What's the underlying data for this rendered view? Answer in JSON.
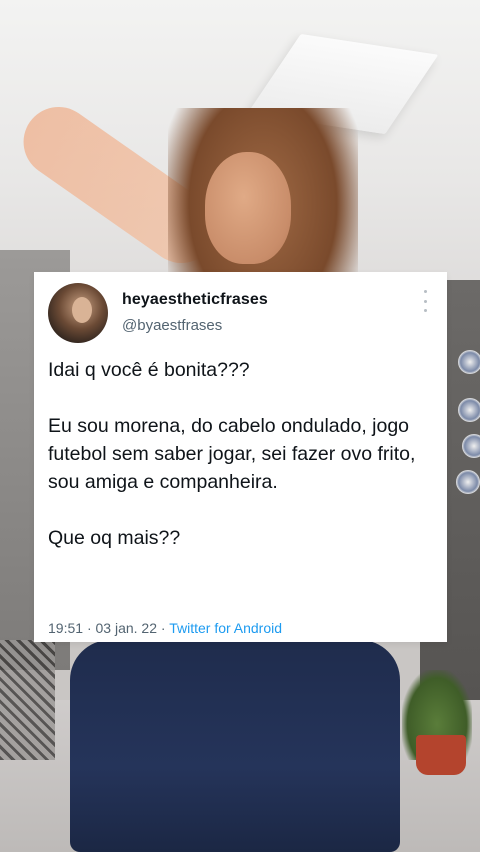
{
  "tweet": {
    "display_name": "heyaestheticfrases",
    "handle": "@byaestfrases",
    "text": "Idai q você é bonita???\n\nEu sou morena, do cabelo ondulado, jogo futebol sem saber jogar, sei fazer ovo frito, sou amiga e companheira.\n\nQue oq mais??",
    "time": "19:51",
    "separator": "·",
    "date": "03 jan. 22",
    "source": "Twitter for Android"
  },
  "icons": {
    "more": "more-vertical-icon",
    "avatar": "profile-avatar"
  },
  "colors": {
    "text": "#0f1419",
    "secondary": "#536471",
    "link": "#1d9bf0",
    "card": "#ffffff"
  }
}
